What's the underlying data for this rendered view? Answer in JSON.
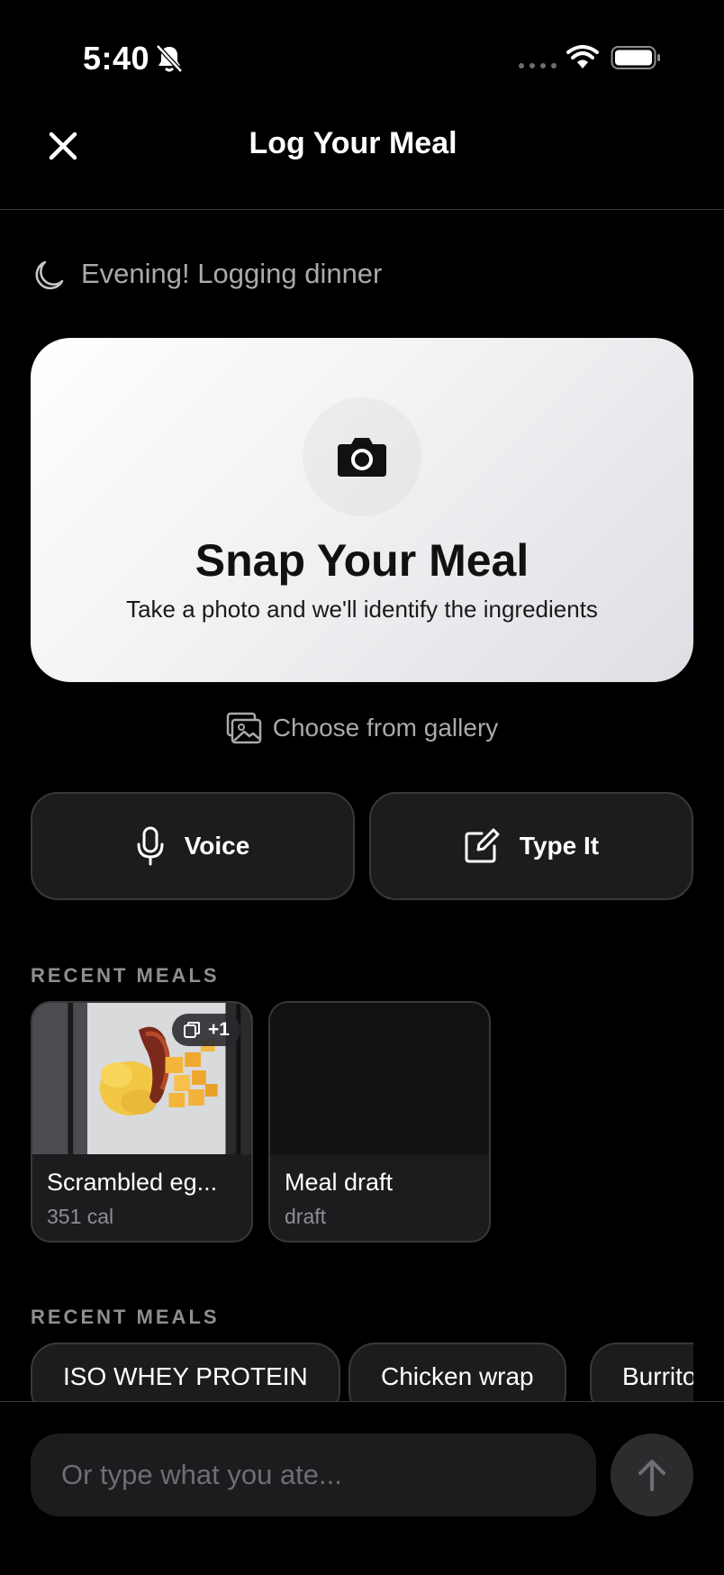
{
  "status_bar": {
    "time": "5:40"
  },
  "header": {
    "title": "Log Your Meal"
  },
  "greeting": "Evening! Logging dinner",
  "snap_card": {
    "title": "Snap Your Meal",
    "subtitle": "Take a photo and we'll identify the ingredients"
  },
  "gallery_label": "Choose from gallery",
  "actions": {
    "voice_label": "Voice",
    "type_label": "Type It"
  },
  "recent_meals_section": {
    "label": "RECENT MEALS",
    "items": [
      {
        "name": "Scrambled eg...",
        "sub": "351 cal",
        "badge": "+1"
      },
      {
        "name": "Meal draft",
        "sub": "draft"
      }
    ]
  },
  "quick_add_section": {
    "label": "RECENT MEALS",
    "chips": [
      "ISO WHEY PROTEIN",
      "Chicken wrap",
      "Burrito"
    ]
  },
  "input": {
    "placeholder": "Or type what you ate..."
  }
}
